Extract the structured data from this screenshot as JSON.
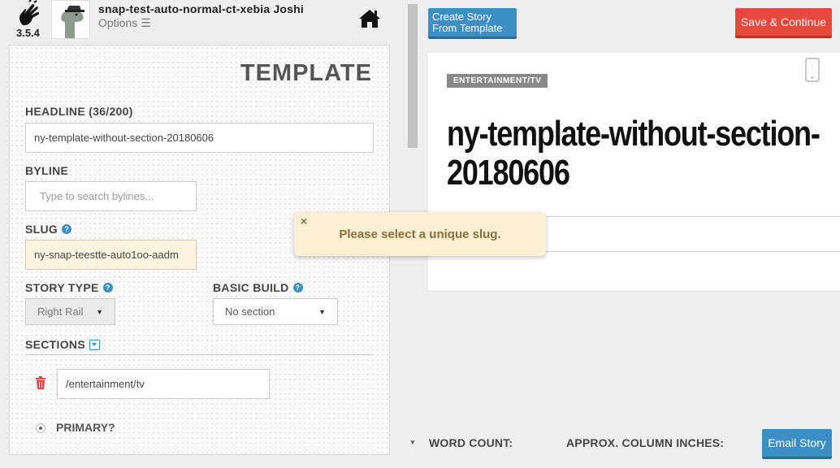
{
  "app": {
    "version": "3.5.4",
    "logo_icon": "hand-logo-icon",
    "user_name": "snap-test-auto-normal-ct-xebia Joshi",
    "options_label": "Options ☰"
  },
  "form": {
    "title": "TEMPLATE",
    "headline_label": "HEADLINE (36/200)",
    "headline_value": "ny-template-without-section-20180606",
    "byline_label": "BYLINE",
    "byline_placeholder": "Type to search bylines...",
    "slug_label": "SLUG",
    "slug_value": "ny-snap-teestte-auto1oo-aadm",
    "story_type_label": "STORY TYPE",
    "story_type_value": "Right Rail",
    "basic_build_label": "BASIC BUILD",
    "basic_build_value": "No section",
    "sections_label": "SECTIONS",
    "section_value": "/entertainment/tv",
    "primary_label": "PRIMARY?"
  },
  "buttons": {
    "create_from_template": "Create Story From Template",
    "save_continue": "Save & Continue",
    "email_story": "Email Story"
  },
  "preview": {
    "category": "ENTERTAINMENT/TV",
    "headline": "ny-template-without-section-20180606"
  },
  "toast": {
    "close": "×",
    "message": "Please select a unique slug."
  },
  "footer": {
    "word_count_label": "WORD COUNT:",
    "column_inches_label": "APPROX. COLUMN INCHES:"
  },
  "colors": {
    "primary_blue": "#3b8fc4",
    "save_red": "#e8473c",
    "toast_bg": "#fdefd3",
    "toast_text": "#8a6d3b"
  }
}
